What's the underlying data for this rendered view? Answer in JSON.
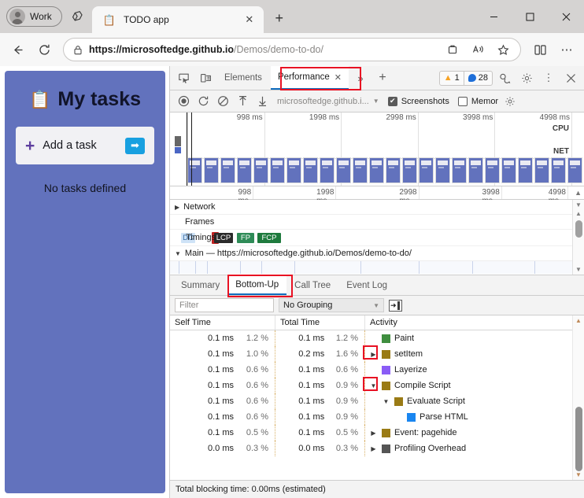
{
  "browser": {
    "profile_label": "Work",
    "tab_title": "TODO app",
    "tab_favicon": "clipboard-icon",
    "close_tab_glyph": "✕",
    "new_tab_glyph": "+",
    "window_minimize": "—",
    "window_maximize": "▢",
    "window_close": "✕",
    "back_glyph": "←",
    "reload_glyph": "⟳",
    "url_scheme": "https://",
    "url_host": "microsoftedge.github.io",
    "url_path": "/Demos/demo-to-do/",
    "full_url": "https://microsoftedge.github.io/Demos/demo-to-do/",
    "omni_actions": [
      "collections-icon",
      "read-aloud-icon",
      "favorite-star-icon"
    ],
    "split_screen_glyph": "▯▯",
    "settings_more_glyph": "⋯"
  },
  "page": {
    "title": "My tasks",
    "title_icon": "clipboard-icon",
    "add_task_label": "Add a task",
    "add_task_plus": "+",
    "add_task_go": "➡",
    "empty_state": "No tasks defined",
    "panel_color": "#6272bd"
  },
  "devtools": {
    "tabs": [
      {
        "label": "Elements",
        "active": false
      },
      {
        "label": "Performance",
        "active": true,
        "closable": true
      }
    ],
    "more_tabs_glyph": "»",
    "add_tab_glyph": "+",
    "inspect_icon": "inspect-element-icon",
    "device_icon": "device-emulation-icon",
    "warning_count": "1",
    "message_count": "28",
    "customize_icon": "customize-icon",
    "settings_icon": "gear-icon",
    "more_icon": "more-vertical-icon",
    "close_icon": "close-icon",
    "controls": {
      "record_glyph": "◉",
      "reload_record_glyph": "⟳",
      "clear_glyph": "⊘",
      "upload_glyph": "↑",
      "download_glyph": "↓",
      "origin_label": "microsoftedge.github.i...",
      "screenshots_label": "Screenshots",
      "screenshots_checked": true,
      "memory_label": "Memor",
      "memory_checked": false,
      "capture_settings_icon": "gear-icon"
    },
    "overview": {
      "ticks": [
        "998 ms",
        "1998 ms",
        "2998 ms",
        "3998 ms",
        "4998 ms"
      ],
      "cpu_label": "CPU",
      "net_label": "NET",
      "frame_count": 26
    },
    "tracks_ruler_ticks": [
      "998 ms",
      "1998 ms",
      "2998 ms",
      "3998 ms",
      "4998 ms"
    ],
    "tracks": [
      {
        "name": "Network",
        "expander": "▶"
      },
      {
        "name": "Frames",
        "expander": ""
      },
      {
        "name": "Timings",
        "expander": ""
      },
      {
        "name": "Main — https://microsoftedge.github.io/Demos/demo-to-do/",
        "expander": "▼"
      }
    ],
    "timing_markers": [
      {
        "label": "DC",
        "color": "#cfe3f7"
      },
      {
        "label": "LCP",
        "color": "#2a2a2a"
      },
      {
        "label": "FP",
        "color": "#2e8b57"
      },
      {
        "label": "FCP",
        "color": "#1e7a3d"
      }
    ],
    "sub_tabs": [
      {
        "label": "Summary",
        "active": false
      },
      {
        "label": "Bottom-Up",
        "active": true
      },
      {
        "label": "Call Tree",
        "active": false
      },
      {
        "label": "Event Log",
        "active": false
      }
    ],
    "filter_placeholder": "Filter",
    "grouping_value": "No Grouping",
    "grouping_caret": "▼",
    "match_case_icon": "next-sibling-icon",
    "table": {
      "columns": [
        "Self Time",
        "Total Time",
        "Activity"
      ],
      "rows": [
        {
          "self_ms": "0.1 ms",
          "self_pct": "1.2 %",
          "total_ms": "0.1 ms",
          "total_pct": "1.2 %",
          "expander": "",
          "color": "#3f8e3f",
          "activity": "Paint",
          "indent": 0
        },
        {
          "self_ms": "0.1 ms",
          "self_pct": "1.0 %",
          "total_ms": "0.2 ms",
          "total_pct": "1.6 %",
          "expander": "▶",
          "color": "#9a7b15",
          "activity": "setItem",
          "indent": 0
        },
        {
          "self_ms": "0.1 ms",
          "self_pct": "0.6 %",
          "total_ms": "0.1 ms",
          "total_pct": "0.6 %",
          "expander": "",
          "color": "#8a5cf6",
          "activity": "Layerize",
          "indent": 0
        },
        {
          "self_ms": "0.1 ms",
          "self_pct": "0.6 %",
          "total_ms": "0.1 ms",
          "total_pct": "0.9 %",
          "expander": "▼",
          "color": "#9a7b15",
          "activity": "Compile Script",
          "indent": 0
        },
        {
          "self_ms": "0.1 ms",
          "self_pct": "0.6 %",
          "total_ms": "0.1 ms",
          "total_pct": "0.9 %",
          "expander": "▼",
          "color": "#9a7b15",
          "activity": "Evaluate Script",
          "indent": 1
        },
        {
          "self_ms": "0.1 ms",
          "self_pct": "0.6 %",
          "total_ms": "0.1 ms",
          "total_pct": "0.9 %",
          "expander": "",
          "color": "#1a86f0",
          "activity": "Parse HTML",
          "indent": 2
        },
        {
          "self_ms": "0.1 ms",
          "self_pct": "0.5 %",
          "total_ms": "0.1 ms",
          "total_pct": "0.5 %",
          "expander": "▶",
          "color": "#9a7b15",
          "activity": "Event: pagehide",
          "indent": 0
        },
        {
          "self_ms": "0.0 ms",
          "self_pct": "0.3 %",
          "total_ms": "0.0 ms",
          "total_pct": "0.3 %",
          "expander": "▶",
          "color": "#555555",
          "activity": "Profiling Overhead",
          "indent": 0
        }
      ]
    },
    "status_text": "Total blocking time: 0.00ms (estimated)",
    "highlight_color": "#e81123"
  }
}
